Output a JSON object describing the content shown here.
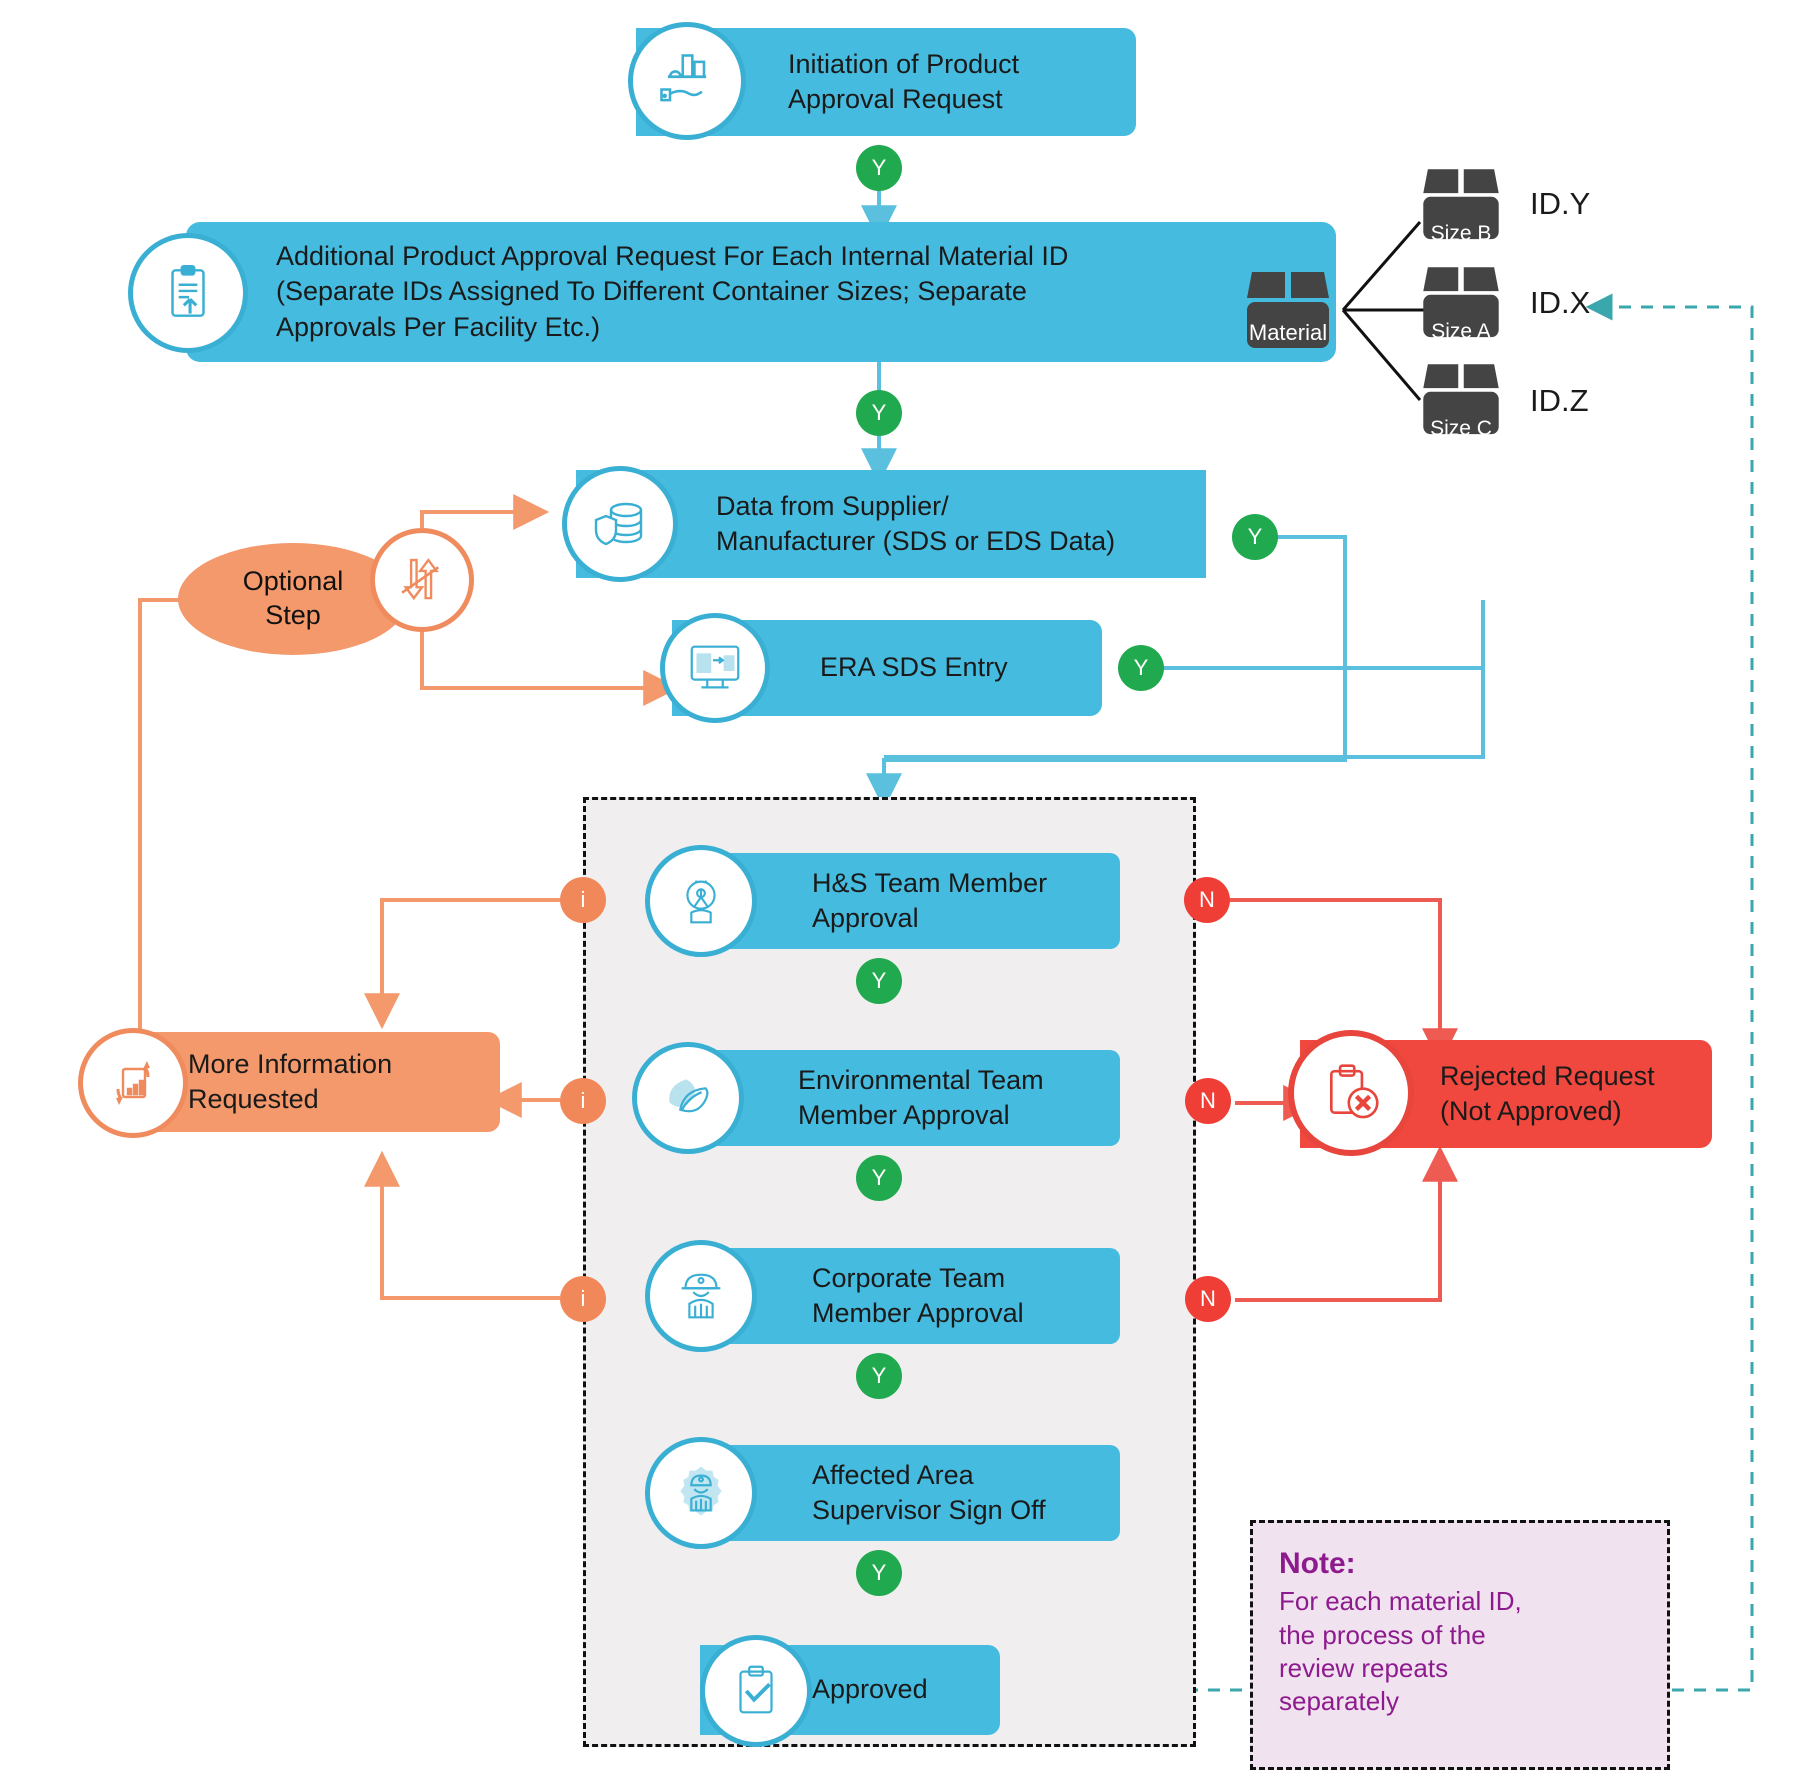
{
  "title": "Product Approval Request Workflow",
  "colors": {
    "blue": "#45bcdf",
    "blue_border": "#3aafd4",
    "orange": "#f3996c",
    "orange_border": "#ef8b5d",
    "red": "#f0483e",
    "green": "#21a94f",
    "note_purple": "#8e1b8e",
    "note_bg": "#f0e3ef",
    "panel_bg": "#f0eeef"
  },
  "nodes": {
    "initiation": {
      "label": "Initiation of Product\nApproval Request",
      "icon": "factory-hand-icon"
    },
    "additional_request": {
      "label": "Additional Product Approval Request For Each Internal Material ID\n(Separate IDs Assigned To Different Container Sizes; Separate\nApprovals Per Facility Etc.)",
      "icon": "document-upload-icon"
    },
    "supplier_data": {
      "label": "Data from Supplier/\nManufacturer (SDS or EDS Data)",
      "icon": "database-shield-icon"
    },
    "era_sds_entry": {
      "label": "ERA SDS Entry",
      "icon": "computer-entry-icon"
    },
    "optional_step": {
      "label": "Optional\nStep",
      "icon": "up-down-arrows-icon"
    },
    "hs_approval": {
      "label": "H&S Team Member\nApproval",
      "icon": "biohazard-worker-icon"
    },
    "env_approval": {
      "label": "Environmental Team\nMember Approval",
      "icon": "leaf-icon"
    },
    "corp_approval": {
      "label": "Corporate Team\nMember Approval",
      "icon": "hardhat-worker-icon"
    },
    "supervisor_signoff": {
      "label": "Affected Area\nSupervisor Sign Off",
      "icon": "gear-worker-icon"
    },
    "approved": {
      "label": "Approved",
      "icon": "clipboard-check-icon"
    },
    "more_info": {
      "label": "More Information\nRequested",
      "icon": "document-refresh-icon"
    },
    "rejected": {
      "label": "Rejected Request\n(Not Approved)",
      "icon": "clipboard-x-icon"
    }
  },
  "material": {
    "box_label": "Material",
    "variants": [
      {
        "size": "Size B",
        "id": "ID.Y"
      },
      {
        "size": "Size A",
        "id": "ID.X"
      },
      {
        "size": "Size C",
        "id": "ID.Z"
      }
    ]
  },
  "badges": {
    "yes": "Y",
    "no": "N",
    "info": "i"
  },
  "note": {
    "heading": "Note:",
    "body": "For each material ID,\nthe process of the\nreview repeats\nseparately"
  }
}
